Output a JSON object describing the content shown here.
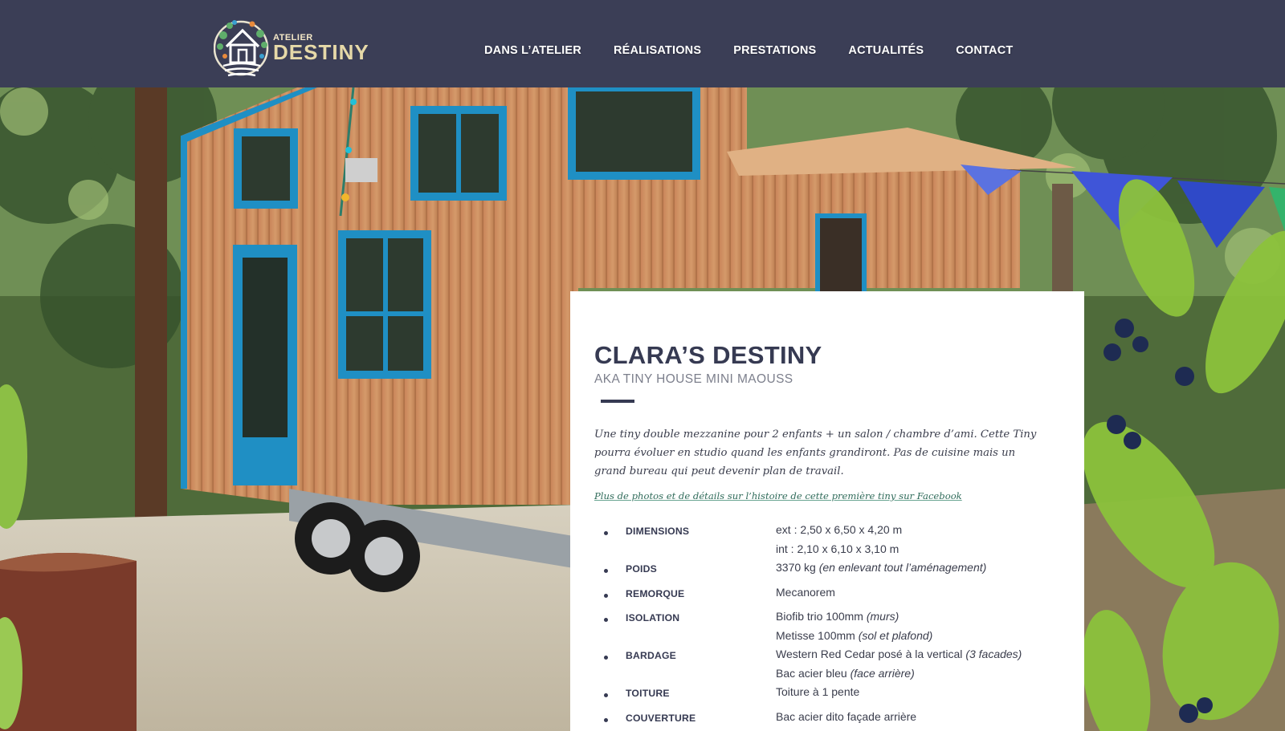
{
  "brand": {
    "logo_small": "ATELIER",
    "logo_big": "DESTINY"
  },
  "nav": [
    {
      "label": "DANS L’ATELIER"
    },
    {
      "label": "RÉALISATIONS"
    },
    {
      "label": "PRESTATIONS"
    },
    {
      "label": "ACTUALITÉS"
    },
    {
      "label": "CONTACT"
    }
  ],
  "project": {
    "title": "CLARA’S DESTINY",
    "subtitle": "AKA TINY HOUSE MINI MAOUSS",
    "description": "Une tiny double mezzanine pour 2 enfants + un salon / chambre d’ami. Cette Tiny pourra évoluer en studio quand les enfants grandiront. Pas de cuisine mais un grand bureau qui peut devenir plan de travail.",
    "facebook_link": "Plus de photos et de détails sur l’histoire de cette première tiny sur Facebook"
  },
  "specs": [
    {
      "label": "DIMENSIONS",
      "lines": [
        {
          "text": "ext : 2,50 x 6,50 x 4,20 m",
          "note": ""
        },
        {
          "text": "int : 2,10 x 6,10 x 3,10 m",
          "note": ""
        }
      ]
    },
    {
      "label": "POIDS",
      "lines": [
        {
          "text": "3370 kg ",
          "note": "(en enlevant tout l’aménagement)"
        }
      ]
    },
    {
      "label": "REMORQUE",
      "lines": [
        {
          "text": "Mecanorem",
          "note": ""
        }
      ]
    },
    {
      "label": "ISOLATION",
      "lines": [
        {
          "text": "Biofib trio 100mm ",
          "note": "(murs)"
        },
        {
          "text": "Metisse 100mm ",
          "note": "(sol et plafond)"
        }
      ]
    },
    {
      "label": "BARDAGE",
      "lines": [
        {
          "text": "Western Red Cedar posé à la vertical ",
          "note": "(3 facades)"
        },
        {
          "text": "Bac acier bleu ",
          "note": "(face arrière)"
        }
      ]
    },
    {
      "label": "TOITURE",
      "lines": [
        {
          "text": "Toiture à 1 pente",
          "note": ""
        }
      ]
    },
    {
      "label": "COUVERTURE",
      "lines": [
        {
          "text": "Bac acier dito façade arrière",
          "note": ""
        }
      ]
    }
  ],
  "colors": {
    "header_bg": "#3b3e56",
    "text_dark": "#363a52",
    "link_green": "#2f6b5a",
    "trim_blue": "#1f8fc4",
    "cedar": "#c98a5a"
  }
}
